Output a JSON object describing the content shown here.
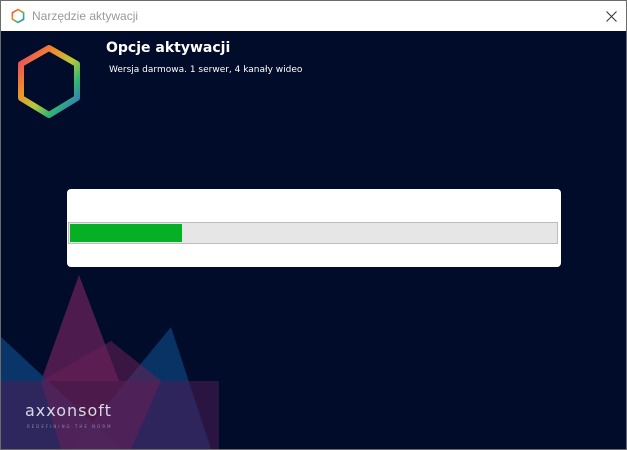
{
  "window": {
    "title": "Narzędzie aktywacji",
    "close_icon": "close-icon",
    "app_icon": "hexagon-logo-icon"
  },
  "header": {
    "title": "Opcje aktywacji",
    "subtitle": "Wersja darmowa. 1 serwer, 4 kanały wideo",
    "logo_icon": "hexagon-logo-icon"
  },
  "progress": {
    "value_fraction": 0.23,
    "fill_color": "#06b025",
    "track_color": "#e6e6e6"
  },
  "brand": {
    "name": "axxonsoft",
    "tagline": "REDEFINING THE NORM",
    "colors": [
      "#5a1f55",
      "#0c3a72"
    ]
  },
  "colors": {
    "background": "#000c2a",
    "card": "#ffffff"
  }
}
